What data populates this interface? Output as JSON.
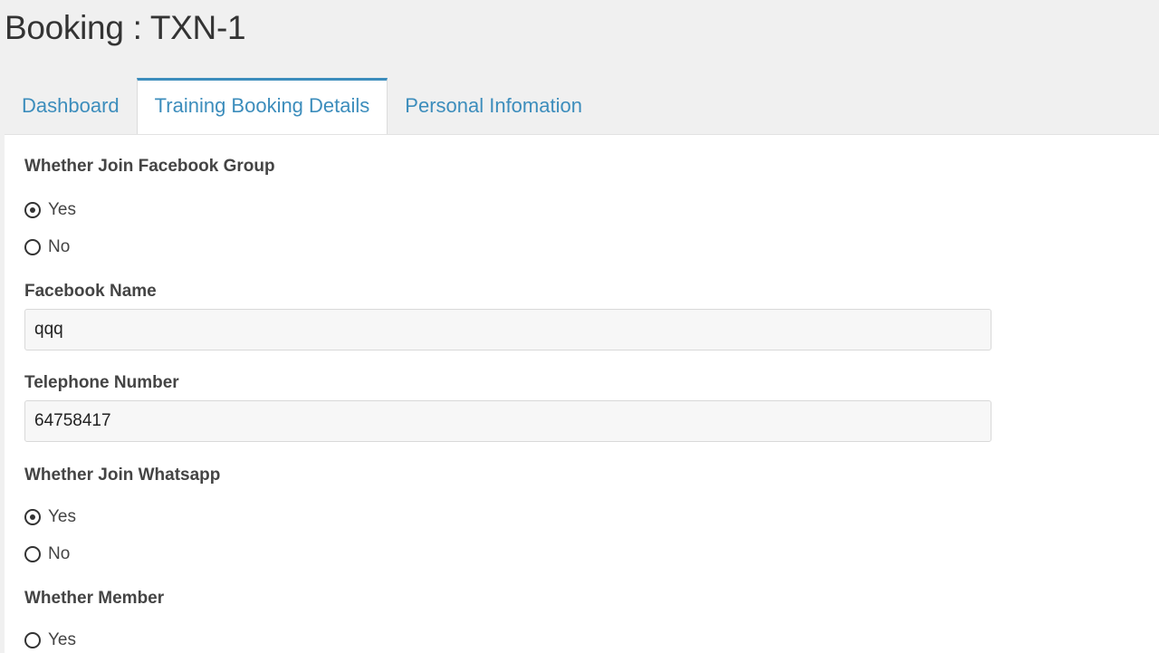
{
  "page": {
    "title": "Booking : TXN-1"
  },
  "tabs": [
    {
      "label": "Dashboard",
      "active": false
    },
    {
      "label": "Training Booking Details",
      "active": true
    },
    {
      "label": "Personal Infomation",
      "active": false
    }
  ],
  "form": {
    "facebook_group": {
      "label": "Whether Join Facebook Group",
      "options": [
        {
          "label": "Yes",
          "checked": true
        },
        {
          "label": "No",
          "checked": false
        }
      ]
    },
    "facebook_name": {
      "label": "Facebook Name",
      "value": "qqq"
    },
    "telephone": {
      "label": "Telephone Number",
      "value": "64758417"
    },
    "whatsapp": {
      "label": "Whether Join Whatsapp",
      "options": [
        {
          "label": "Yes",
          "checked": true
        },
        {
          "label": "No",
          "checked": false
        }
      ]
    },
    "member": {
      "label": "Whether Member",
      "options": [
        {
          "label": "Yes",
          "checked": false
        }
      ]
    }
  },
  "colors": {
    "accent": "#3c8dbc",
    "background": "#f0f0f0",
    "panel": "#ffffff"
  }
}
